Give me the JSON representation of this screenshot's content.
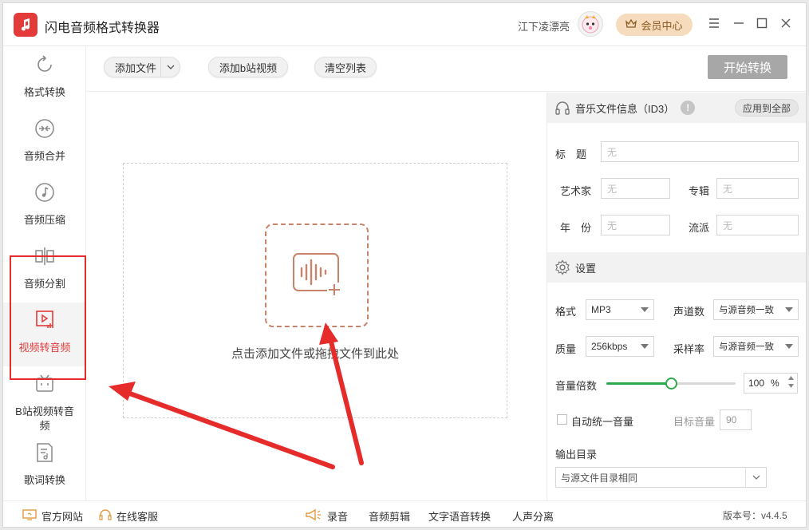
{
  "app": {
    "title": "闪电音频格式转换器",
    "user_name": "江下凌漂亮",
    "vip_label": "会员中心"
  },
  "sidebar": {
    "items": [
      {
        "label": "格式转换",
        "icon": "refresh-icon"
      },
      {
        "label": "音频合并",
        "icon": "merge-icon"
      },
      {
        "label": "音频压缩",
        "icon": "music-note-icon"
      },
      {
        "label": "音频分割",
        "icon": "split-icon"
      },
      {
        "label": "视频转音频",
        "icon": "video-play-icon",
        "active": true
      },
      {
        "label": "B站视频转音频",
        "icon": "bilibili-icon"
      },
      {
        "label": "歌词转换",
        "icon": "lyrics-icon"
      }
    ]
  },
  "toolbar": {
    "add_file": "添加文件",
    "add_bilibili": "添加b站视频",
    "clear_list": "清空列表",
    "start": "开始转换"
  },
  "drop_zone": {
    "hint": "点击添加文件或拖拽文件到此处"
  },
  "id3": {
    "section_title": "音乐文件信息（ID3）",
    "apply_all": "应用到全部",
    "title_label": "标　题",
    "title_placeholder": "无",
    "artist_label": "艺术家",
    "artist_placeholder": "无",
    "album_label": "专辑",
    "album_placeholder": "无",
    "year_label": "年　份",
    "year_placeholder": "无",
    "genre_label": "流派",
    "genre_placeholder": "无"
  },
  "settings": {
    "section_title": "设置",
    "format_label": "格式",
    "format_value": "MP3",
    "channels_label": "声道数",
    "channels_value": "与源音频一致",
    "quality_label": "质量",
    "quality_value": "256kbps",
    "samplerate_label": "采样率",
    "samplerate_value": "与源音频一致",
    "volume_label": "音量倍数",
    "volume_value": "100",
    "volume_unit": "%",
    "volume_fraction": 0.5,
    "auto_normalize_label": "自动统一音量",
    "target_volume_label": "目标音量",
    "target_volume_value": "90",
    "output_dir_label": "输出目录",
    "output_dir_value": "与源文件目录相同"
  },
  "footer": {
    "website": "官方网站",
    "support": "在线客服",
    "record": "录音",
    "audio_edit": "音频剪辑",
    "tts": "文字语音转换",
    "vocal_split": "人声分离",
    "version": "版本号：v4.4.5"
  },
  "colors": {
    "accent_red": "#e43a3a",
    "annotation_red": "#e62b2b",
    "slider_green": "#2eaa4e",
    "drop_border": "#c8836b",
    "vip_bg": "#f6dcbc"
  }
}
